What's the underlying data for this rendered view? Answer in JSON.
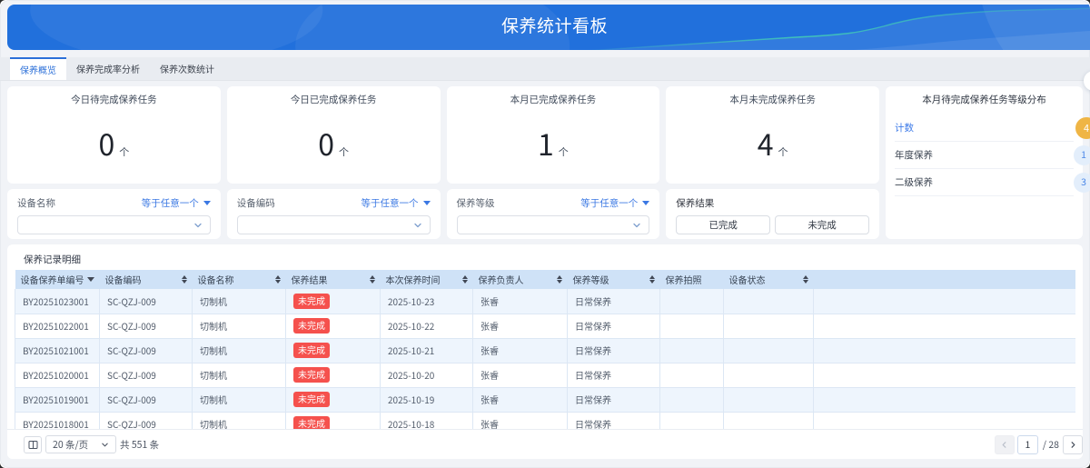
{
  "banner": {
    "title": "保养统计看板"
  },
  "tabs": [
    {
      "label": "保养概览",
      "active": true
    },
    {
      "label": "保养完成率分析",
      "active": false
    },
    {
      "label": "保养次数统计",
      "active": false
    }
  ],
  "stats": [
    {
      "title": "今日待完成保养任务",
      "value": "0",
      "unit": "个"
    },
    {
      "title": "今日已完成保养任务",
      "value": "0",
      "unit": "个"
    },
    {
      "title": "本月已完成保养任务",
      "value": "1",
      "unit": "个"
    },
    {
      "title": "本月未完成保养任务",
      "value": "4",
      "unit": "个"
    }
  ],
  "distribution": {
    "title": "本月待完成保养任务等级分布",
    "rows": [
      {
        "label": "计数",
        "value": "4",
        "badge": "orange"
      },
      {
        "label": "年度保养",
        "value": "1",
        "badge": "blue"
      },
      {
        "label": "二级保养",
        "value": "3",
        "badge": "blue"
      }
    ]
  },
  "filters": [
    {
      "label": "设备名称",
      "operator": "等于任意一个",
      "value": ""
    },
    {
      "label": "设备编码",
      "operator": "等于任意一个",
      "value": ""
    },
    {
      "label": "保养等级",
      "operator": "等于任意一个",
      "value": ""
    },
    {
      "label": "保养结果",
      "buttons": [
        "已完成",
        "未完成"
      ]
    }
  ],
  "table": {
    "section_title": "保养记录明细",
    "columns": [
      {
        "label": "设备保养单编号",
        "sort": "desc"
      },
      {
        "label": "设备编码",
        "sort": "both"
      },
      {
        "label": "设备名称",
        "sort": "both"
      },
      {
        "label": "保养结果",
        "sort": "both"
      },
      {
        "label": "本次保养时间",
        "sort": "both"
      },
      {
        "label": "保养负责人",
        "sort": "both"
      },
      {
        "label": "保养等级",
        "sort": "both"
      },
      {
        "label": "保养拍照",
        "sort": "none"
      },
      {
        "label": "设备状态",
        "sort": "both"
      }
    ],
    "rows": [
      {
        "order_no": "BY20251023001",
        "device_code": "SC-QZJ-009",
        "device_name": "切制机",
        "result": "未完成",
        "time": "2025-10-23",
        "person": "张睿",
        "level": "日常保养",
        "photo": "",
        "status": ""
      },
      {
        "order_no": "BY20251022001",
        "device_code": "SC-QZJ-009",
        "device_name": "切制机",
        "result": "未完成",
        "time": "2025-10-22",
        "person": "张睿",
        "level": "日常保养",
        "photo": "",
        "status": ""
      },
      {
        "order_no": "BY20251021001",
        "device_code": "SC-QZJ-009",
        "device_name": "切制机",
        "result": "未完成",
        "time": "2025-10-21",
        "person": "张睿",
        "level": "日常保养",
        "photo": "",
        "status": ""
      },
      {
        "order_no": "BY20251020001",
        "device_code": "SC-QZJ-009",
        "device_name": "切制机",
        "result": "未完成",
        "time": "2025-10-20",
        "person": "张睿",
        "level": "日常保养",
        "photo": "",
        "status": ""
      },
      {
        "order_no": "BY20251019001",
        "device_code": "SC-QZJ-009",
        "device_name": "切制机",
        "result": "未完成",
        "time": "2025-10-19",
        "person": "张睿",
        "level": "日常保养",
        "photo": "",
        "status": ""
      },
      {
        "order_no": "BY20251018001",
        "device_code": "SC-QZJ-009",
        "device_name": "切制机",
        "result": "未完成",
        "time": "2025-10-18",
        "person": "张睿",
        "level": "日常保养",
        "photo": "",
        "status": ""
      }
    ]
  },
  "pagination": {
    "page_size": "20 条/页",
    "total": "共 551 条",
    "current_page": "1",
    "page_suffix": "/ 28",
    "prev_label": "‹",
    "next_label": "›"
  },
  "colors": {
    "banner_blue": "#2170DC",
    "accent_blue": "#3B78E3",
    "table_header_bg": "#CFE2F7",
    "row_stripe_bg": "#EEF5FD",
    "badge_red": "#F5514D",
    "badge_orange": "#EFB545",
    "badge_light_blue": "#E3EEFB"
  }
}
